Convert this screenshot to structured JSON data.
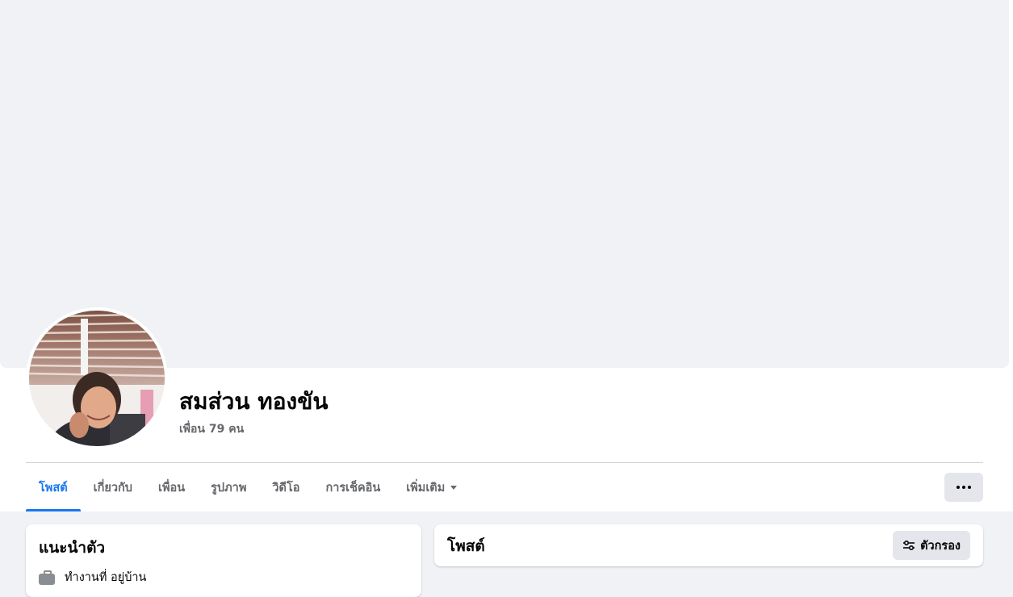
{
  "profile": {
    "name": "สมส่วน ทองขัน",
    "friend_count_text": "เพื่อน 79 คน"
  },
  "tabs": [
    {
      "label": "โพสต์",
      "active": true
    },
    {
      "label": "เกี่ยวกับ",
      "active": false
    },
    {
      "label": "เพื่อน",
      "active": false
    },
    {
      "label": "รูปภาพ",
      "active": false
    },
    {
      "label": "วิดีโอ",
      "active": false
    },
    {
      "label": "การเช็คอิน",
      "active": false
    },
    {
      "label": "เพิ่มเติม",
      "active": false,
      "has_dropdown": true
    }
  ],
  "intro": {
    "title": "แนะนำตัว",
    "work_text": "ทำงานที่ อยู่บ้าน",
    "work_icon": "briefcase-icon"
  },
  "posts": {
    "title": "โพสต์",
    "filter_label": "ตัวกรอง",
    "filter_icon": "sliders-icon"
  },
  "colors": {
    "accent": "#1877f2",
    "background": "#f0f2f5",
    "secondary_text": "#65676b",
    "button_bg": "#e4e6eb"
  }
}
